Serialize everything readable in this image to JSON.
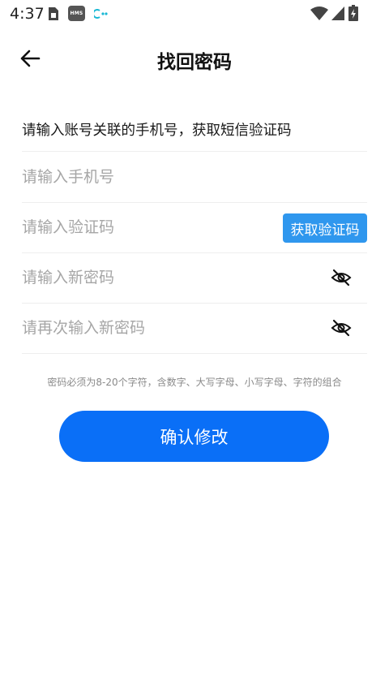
{
  "status_bar": {
    "time": "4:37",
    "hms_label": "HMS",
    "icons": [
      "sim-card-icon",
      "hms-icon",
      "app-notification-icon",
      "wifi-icon",
      "cellular-signal-icon",
      "battery-charging-icon"
    ]
  },
  "header": {
    "back_icon": "arrow-left-icon",
    "title": "找回密码"
  },
  "form": {
    "instruction": "请输入账号关联的手机号，获取短信验证码",
    "phone": {
      "placeholder": "请输入手机号",
      "value": ""
    },
    "code": {
      "placeholder": "请输入验证码",
      "value": "",
      "button_label": "获取验证码"
    },
    "new_password": {
      "placeholder": "请输入新密码",
      "value": "",
      "toggle_icon": "eye-off-icon"
    },
    "confirm_password": {
      "placeholder": "请再次输入新密码",
      "value": "",
      "toggle_icon": "eye-off-icon"
    },
    "hint": "密码必须为8-20个字符，含数字、大写字母、小写字母、字符的组合"
  },
  "submit": {
    "label": "确认修改"
  },
  "colors": {
    "primary": "#0a6ff7",
    "code_button": "#2f97ee",
    "placeholder": "#a6a6a6",
    "divider": "#eeeeee"
  }
}
